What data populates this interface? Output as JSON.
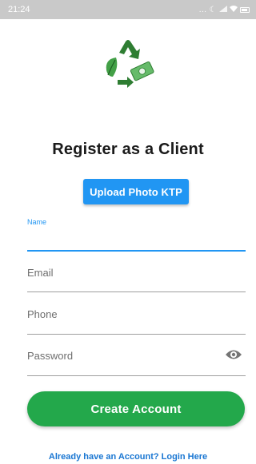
{
  "status_bar": {
    "time": "21:24",
    "indicators": "...",
    "icons": [
      "moon-icon",
      "signal-icon",
      "wifi-icon",
      "battery-icon"
    ]
  },
  "logo": {
    "icon": "recycle-money-logo",
    "colors": {
      "arrow": "#2e7d32",
      "leaf": "#43a047",
      "bill": "#66bb6a"
    }
  },
  "page_title": "Register as a Client",
  "upload_button": {
    "label": "Upload Photo KTP",
    "color": "#2196f3"
  },
  "form": {
    "name": {
      "label": "Name",
      "value": ""
    },
    "email": {
      "placeholder": "Email",
      "value": ""
    },
    "phone": {
      "placeholder": "Phone",
      "value": ""
    },
    "password": {
      "placeholder": "Password",
      "value": "",
      "toggle_icon": "eye-icon"
    }
  },
  "create_button": {
    "label": "Create Account",
    "color": "#23a84b"
  },
  "login_link": "Already have an Account? Login Here"
}
